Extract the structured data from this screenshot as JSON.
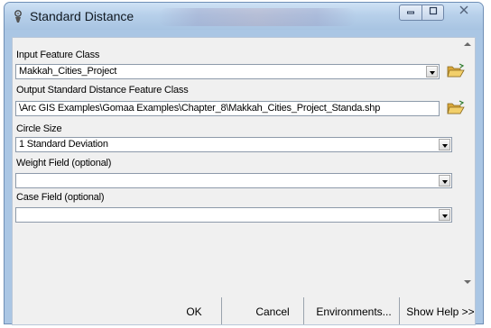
{
  "window": {
    "title": "Standard Distance",
    "buttons": {
      "minimize": "▭",
      "maximize": "□",
      "close": "X"
    }
  },
  "form": {
    "input_feature_class": {
      "label": "Input Feature Class",
      "value": "Makkah_Cities_Project"
    },
    "output_feature_class": {
      "label": "Output Standard Distance Feature Class",
      "value": "\\Arc GIS Examples\\Gomaa Examples\\Chapter_8\\Makkah_Cities_Project_Standa.shp"
    },
    "circle_size": {
      "label": "Circle Size",
      "value": "1 Standard Deviation"
    },
    "weight_field": {
      "label": "Weight Field (optional)",
      "value": ""
    },
    "case_field": {
      "label": "Case Field (optional)",
      "value": ""
    }
  },
  "footer": {
    "ok_label": "OK",
    "cancel_label": "Cancel",
    "environments_label": "Environments...",
    "show_help_label": "Show Help >>"
  },
  "colors": {
    "title_bar": "#b7d0ea",
    "client_bg": "#f0f0f0",
    "field_bg": "#ffffff",
    "folder_icon": "#e6b84a"
  },
  "icons": {
    "app": "tool-icon",
    "browse": "open-folder-icon"
  }
}
